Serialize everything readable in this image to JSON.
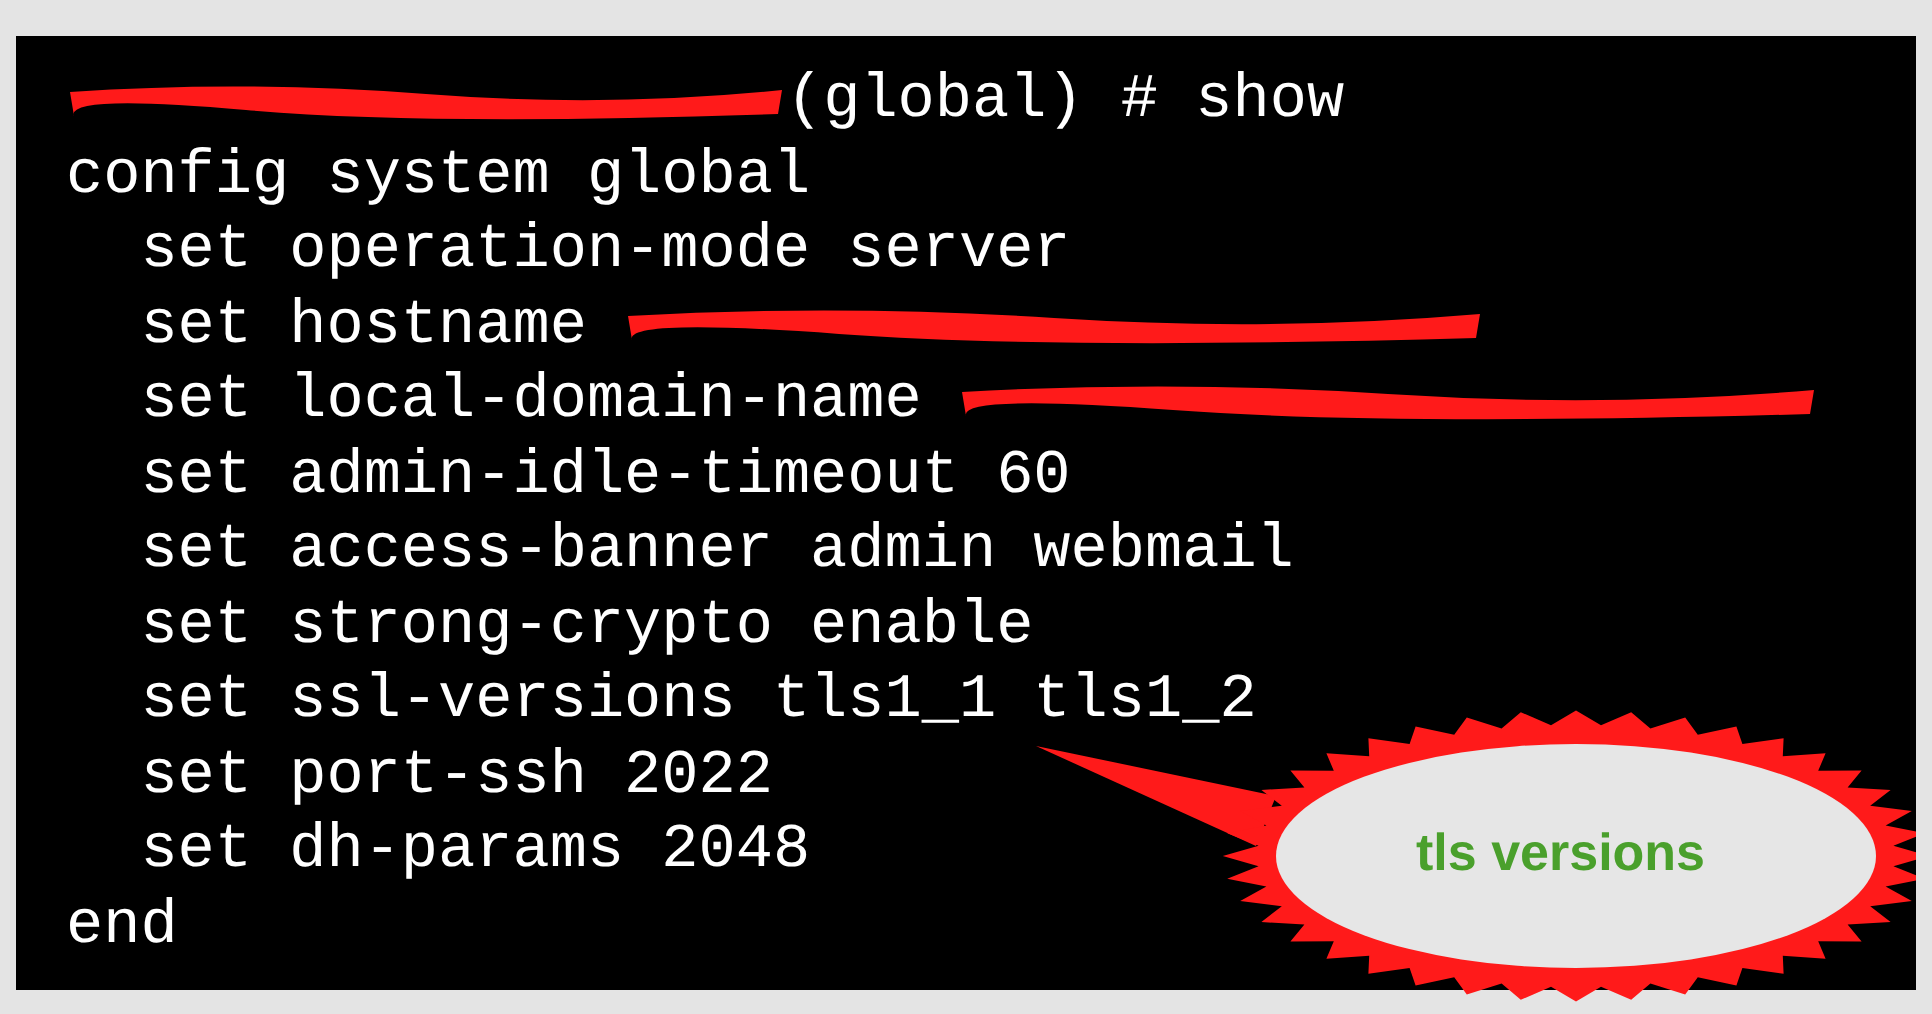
{
  "terminal": {
    "lines": [
      {
        "kind": "redacted_prefix",
        "text": "(global) # show"
      },
      {
        "kind": "plain",
        "text": "config system global"
      },
      {
        "kind": "plain",
        "text": "  set operation-mode server"
      },
      {
        "kind": "redacted_suffix",
        "text": "  set hostname "
      },
      {
        "kind": "redacted_suffix",
        "text": "  set local-domain-name "
      },
      {
        "kind": "plain",
        "text": "  set admin-idle-timeout 60"
      },
      {
        "kind": "plain",
        "text": "  set access-banner admin webmail"
      },
      {
        "kind": "plain",
        "text": "  set strong-crypto enable"
      },
      {
        "kind": "plain",
        "text": "  set ssl-versions tls1_1 tls1_2"
      },
      {
        "kind": "plain",
        "text": "  set port-ssh 2022"
      },
      {
        "kind": "plain",
        "text": "  set dh-params 2048"
      },
      {
        "kind": "plain",
        "text": "end"
      }
    ]
  },
  "callout": {
    "label": "tls versions"
  }
}
